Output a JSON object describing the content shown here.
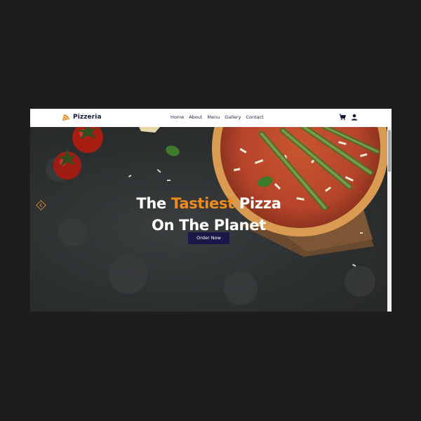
{
  "brand": {
    "name": "Pizzeria"
  },
  "nav": {
    "links": [
      {
        "label": "Home"
      },
      {
        "label": "About"
      },
      {
        "label": "Menu"
      },
      {
        "label": "Gallery"
      },
      {
        "label": "Contact"
      }
    ],
    "icons": [
      "cart-icon",
      "user-icon"
    ]
  },
  "hero": {
    "title_prefix": "The",
    "title_accent": "Tastiest",
    "title_suffix": "Pizza",
    "title_line2": "On The Planet",
    "cta_label": "Order Now"
  },
  "colors": {
    "accent": "#f08a1c",
    "brand_dark": "#1b1747",
    "nav_background": "#ffffff",
    "page_background": "#1d1d1e",
    "hero_background": "#2d3031"
  }
}
